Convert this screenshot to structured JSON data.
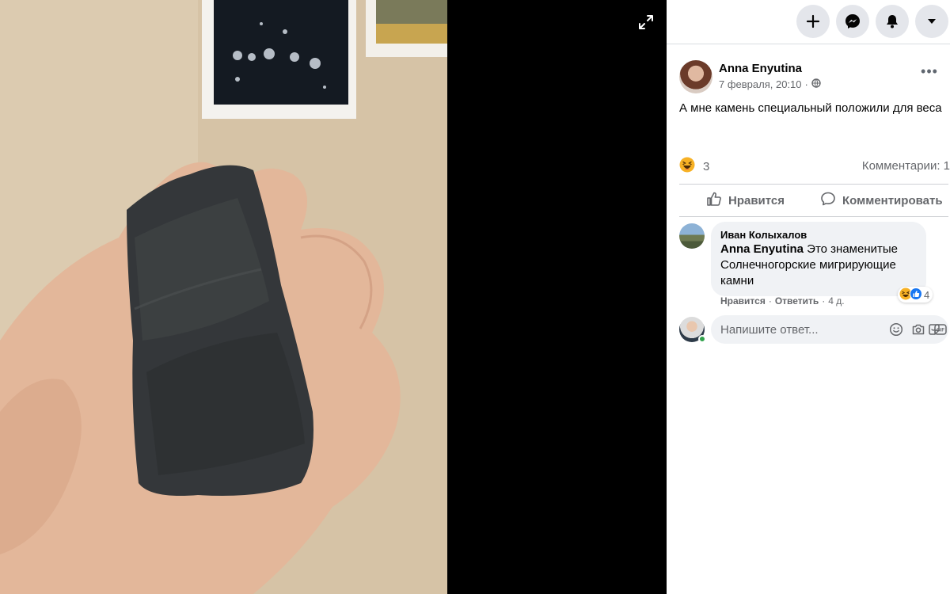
{
  "post": {
    "author": "Anna Enyutina",
    "date": "7 февраля, 20:10",
    "text": "А мне камень специальный положили для веса",
    "reactions_count": "3",
    "comments_label": "Комментарии: 1"
  },
  "actions": {
    "like": "Нравится",
    "comment": "Комментировать"
  },
  "comment": {
    "author": "Иван Колыхалов",
    "mention": "Anna Enyutina",
    "text": " Это знаменитые Солнечногорские мигрирующие камни",
    "like": "Нравится",
    "separator": "·",
    "reply": "Ответить",
    "time": "4 д.",
    "reactions_count": "4"
  },
  "reply": {
    "placeholder": "Напишите ответ..."
  },
  "icons": {
    "top": [
      "plus-icon",
      "messenger-icon",
      "bell-icon",
      "caret-down-icon"
    ],
    "input": [
      "emoji-icon",
      "camera-icon",
      "gif-icon",
      "sticker-icon"
    ]
  },
  "colors": {
    "panel_bg": "#ffffff",
    "secondary_text": "#65676b",
    "online": "#31a24c"
  }
}
